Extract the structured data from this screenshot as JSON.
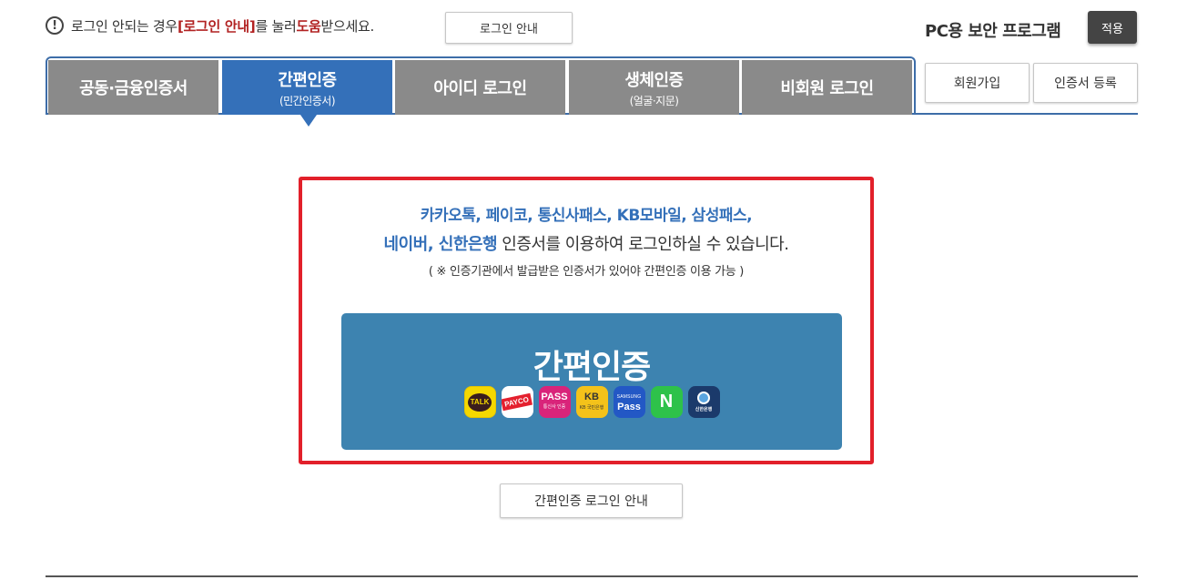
{
  "notice": {
    "icon": "exclamation-circle-icon",
    "prefix": "로그인 안되는 경우 ",
    "highlight1": "[로그인 안내]",
    "middle": "를 눌러 ",
    "highlight2": "도움",
    "suffix": "받으세요."
  },
  "header": {
    "login_guide_label": "로그인 안내",
    "pc_security_label": "PC용 보안 프로그램",
    "apply_label": "적용"
  },
  "tabs": [
    {
      "label": "공동·금융인증서",
      "sub": ""
    },
    {
      "label": "간편인증",
      "sub": "(민간인증서)"
    },
    {
      "label": "아이디 로그인",
      "sub": ""
    },
    {
      "label": "생체인증",
      "sub": "(얼굴·지문)"
    },
    {
      "label": "비회원 로그인",
      "sub": ""
    }
  ],
  "side_buttons": {
    "signup_label": "회원가입",
    "cert_register_label": "인증서 등록"
  },
  "main": {
    "providers_line": "카카오톡, 페이코, 통신사패스, KB모바일, 삼성패스,",
    "providers_line2_blue": "네이버, 신한은행",
    "providers_line2_rest": " 인증서를 이용하여 로그인하실 수 있습니다.",
    "note": "( ※ 인증기관에서 발급받은 인증서가 있어야 간편인증 이용 가능 )",
    "simple_auth_label": "간편인증",
    "icons": {
      "kakao": "TALK",
      "payco": "PAYCO",
      "pass": "PASS",
      "pass_sub": "통신사 인증",
      "kb": "KB",
      "kb_sub": "KB 국민은행",
      "samsung_top": "SAMSUNG",
      "samsung": "Pass",
      "naver": "N",
      "shinhan": "신한은행"
    },
    "simple_guide_label": "간편인증 로그인 안내"
  },
  "colors": {
    "tab_active": "#3470b9",
    "tab_inactive": "#8a8a8a",
    "highlight_border": "#e2202a",
    "auth_button": "#3d83b0",
    "notice_highlight": "#b22222"
  }
}
